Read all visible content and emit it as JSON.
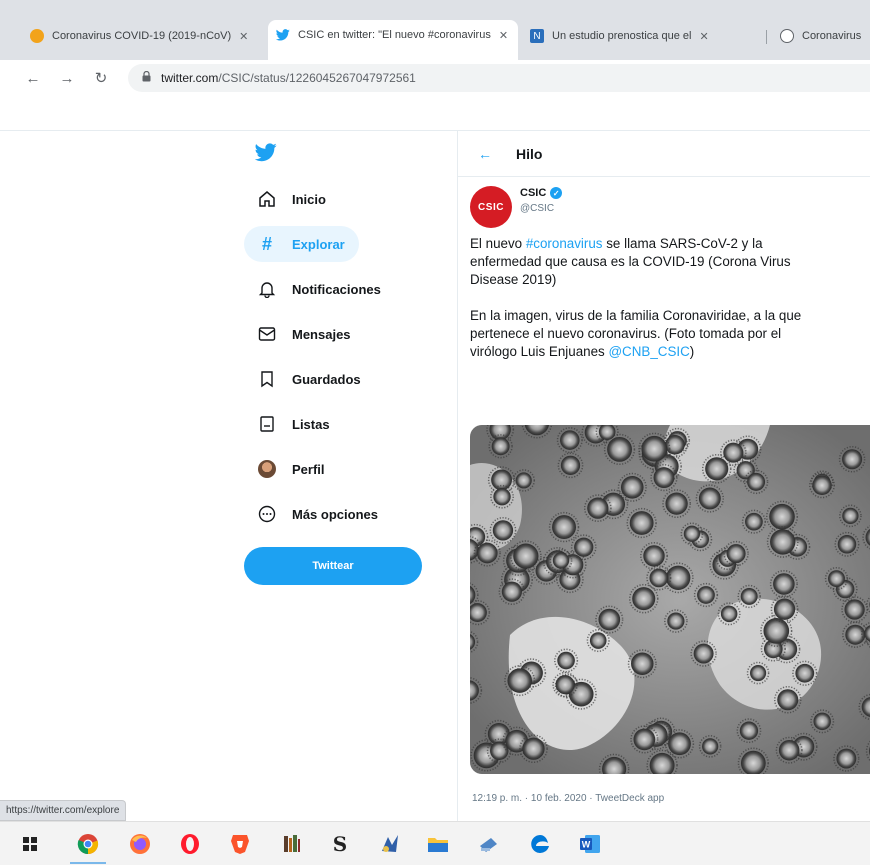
{
  "browser": {
    "tabs": [
      {
        "title": "Coronavirus COVID-19 (2019-nCoV)",
        "favicon": "covid-favicon",
        "color": "#f2a31b"
      },
      {
        "title": "CSIC en twitter: \"El nuevo #coronavirus",
        "favicon": "twitter-favicon",
        "color": "#1da1f2",
        "active": true
      },
      {
        "title": "Un estudio prenostica que el",
        "favicon": "news-favicon",
        "color": "#2a6ebb"
      },
      {
        "title": "Coronavirus",
        "favicon": "globe-favicon",
        "color": "#5f6368"
      }
    ],
    "url_host": "twitter.com",
    "url_path": "/CSIC/status/1226045267047972561"
  },
  "nav": {
    "items": [
      {
        "label": "Inicio",
        "icon": "home-icon"
      },
      {
        "label": "Explorar",
        "icon": "hashtag-icon",
        "active": true
      },
      {
        "label": "Notificaciones",
        "icon": "bell-icon"
      },
      {
        "label": "Mensajes",
        "icon": "mail-icon"
      },
      {
        "label": "Guardados",
        "icon": "bookmark-icon"
      },
      {
        "label": "Listas",
        "icon": "list-icon"
      },
      {
        "label": "Perfil",
        "icon": "profile-avatar"
      },
      {
        "label": "Más opciones",
        "icon": "more-icon"
      }
    ],
    "tweet_button": "Twittear"
  },
  "main": {
    "header_title": "Hilo",
    "tweet": {
      "author": "CSIC",
      "handle": "@CSIC",
      "avatar_text": "CSIC",
      "text_line1_pre": "El nuevo ",
      "hashtag": "#coronavirus",
      "text_line1_post": " se llama SARS-CoV-2 y la",
      "text_line2": "enfermedad que causa es la COVID-19 (Corona Virus",
      "text_line3": "Disease 2019)",
      "text_line4": "En la imagen, virus de la familia Coronaviridae, a la que",
      "text_line5": "pertenece el nuevo coronavirus. (Foto tomada por el",
      "text_line6_pre": "virólogo Luis Enjuanes ",
      "mention": "@CNB_CSIC",
      "text_line6_post": ")",
      "meta": "12:19 p. m. · 10 feb. 2020 · TweetDeck app"
    }
  },
  "status_url": "https://twitter.com/explore",
  "taskbar": {
    "icons": [
      "windows-start-icon",
      "chrome-icon",
      "firefox-icon",
      "opera-icon",
      "brave-icon",
      "library-icon",
      "scrivener-icon",
      "photo-icon",
      "file-explorer-icon",
      "disk-icon",
      "edge-icon",
      "word-icon"
    ]
  }
}
